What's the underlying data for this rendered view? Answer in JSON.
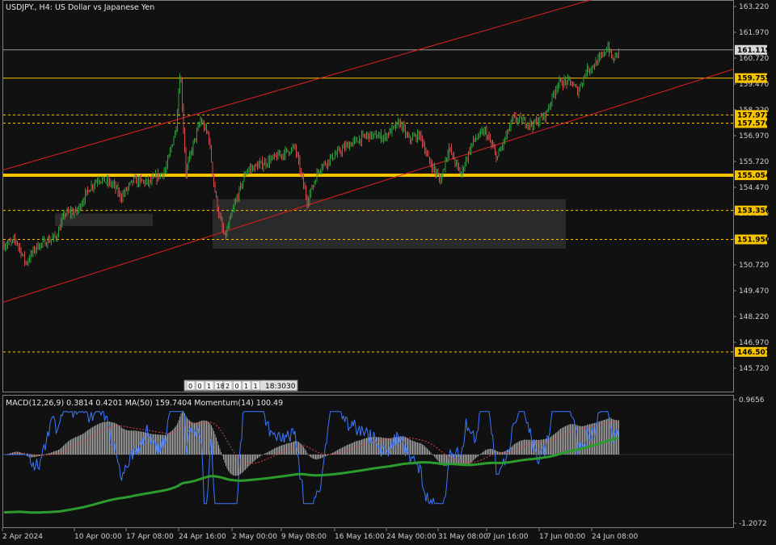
{
  "header": {
    "title": "USDJPY., H4:  US Dollar vs Japanese Yen",
    "macd_label": "MACD(12,26,9) 0.3814 0.4201 MA(50) 159.7404 Momentum(14) 100.49"
  },
  "colors": {
    "background": "#111111",
    "frame": "#808080",
    "bull_candle": "#2e9c3a",
    "bear_candle": "#d24a4a",
    "channel": "#e02020",
    "level": "#f5c300",
    "zone": "#2a2a2a",
    "macd_hist": "#c8c8c8",
    "macd_signal": "#e04040",
    "momentum": "#3a78ff",
    "ma": "#2c9c2c"
  },
  "chart_data": [
    {
      "type": "candlestick",
      "name": "USDJPY., H4",
      "y_ticks": [
        "163.220",
        "161.970",
        "160.720",
        "159.470",
        "158.220",
        "156.970",
        "155.720",
        "154.470",
        "153.220",
        "151.970",
        "150.720",
        "149.470",
        "148.220",
        "146.970",
        "145.720"
      ],
      "ylim": [
        144.7,
        163.55
      ],
      "x_ticks": [
        "2 Apr 2024",
        "10 Apr 00:00",
        "17 Apr 08:00",
        "24 Apr 16:00",
        "2 May 00:00",
        "9 May 08:00",
        "16 May 16:00",
        "24 May 00:00",
        "31 May 08:00",
        "7 Jun 16:00",
        "17 Jun 00:00",
        "24 Jun 08:00"
      ],
      "current_price": "161.119",
      "levels": [
        {
          "price": 159.755,
          "label": "159.755",
          "style": "solid"
        },
        {
          "price": 157.972,
          "label": "157.972",
          "style": "dashed"
        },
        {
          "price": 157.576,
          "label": "157.576",
          "style": "dashed"
        },
        {
          "price": 155.054,
          "label": "155.054",
          "style": "thick"
        },
        {
          "price": 153.35,
          "label": "153.350",
          "style": "dashed"
        },
        {
          "price": 151.95,
          "label": "151.950",
          "style": "dashed"
        },
        {
          "price": 146.507,
          "label": "146.507",
          "style": "dashed"
        }
      ],
      "channel_lines": [
        {
          "from": {
            "x": "2 Apr 2024",
            "y": 155.3
          },
          "to": {
            "x": "24 Jun 08:00",
            "y": 163.55
          }
        },
        {
          "from": {
            "x": "2 Apr 2024",
            "y": 148.9
          },
          "to": {
            "x": "24 Jun 08:00",
            "y": 158.0
          }
        }
      ],
      "zones": [
        {
          "x_start": "10 Apr 00:00",
          "x_end": "17 Apr 08:00",
          "y_low": 152.6,
          "y_high": 153.2
        },
        {
          "x_start": "2 May 00:00",
          "x_end": "17 Jun 00:00",
          "y_low": 151.5,
          "y_high": 153.9
        }
      ],
      "path_points": [
        [
          0,
          151.6
        ],
        [
          20,
          151.9
        ],
        [
          32,
          150.8
        ],
        [
          45,
          151.6
        ],
        [
          60,
          151.9
        ],
        [
          70,
          152.1
        ],
        [
          80,
          153.2
        ],
        [
          95,
          153.3
        ],
        [
          110,
          154.4
        ],
        [
          122,
          154.9
        ],
        [
          140,
          154.6
        ],
        [
          150,
          154.0
        ],
        [
          165,
          154.8
        ],
        [
          185,
          154.7
        ],
        [
          205,
          155.3
        ],
        [
          218,
          157.4
        ],
        [
          223,
          160.2
        ],
        [
          230,
          155.2
        ],
        [
          238,
          156.4
        ],
        [
          248,
          157.7
        ],
        [
          258,
          157.0
        ],
        [
          265,
          154.5
        ],
        [
          270,
          153.3
        ],
        [
          278,
          152.0
        ],
        [
          290,
          153.6
        ],
        [
          305,
          155.3
        ],
        [
          325,
          155.6
        ],
        [
          345,
          156.0
        ],
        [
          365,
          156.4
        ],
        [
          380,
          153.8
        ],
        [
          395,
          155.4
        ],
        [
          410,
          155.9
        ],
        [
          430,
          156.5
        ],
        [
          455,
          157.0
        ],
        [
          475,
          156.9
        ],
        [
          495,
          157.6
        ],
        [
          505,
          156.8
        ],
        [
          520,
          157.0
        ],
        [
          530,
          155.8
        ],
        [
          545,
          154.8
        ],
        [
          555,
          156.4
        ],
        [
          570,
          155.1
        ],
        [
          585,
          156.7
        ],
        [
          600,
          157.2
        ],
        [
          615,
          155.9
        ],
        [
          635,
          157.8
        ],
        [
          660,
          157.5
        ],
        [
          675,
          158.0
        ],
        [
          690,
          159.5
        ],
        [
          705,
          159.6
        ],
        [
          715,
          159.1
        ],
        [
          725,
          160.1
        ],
        [
          735,
          160.4
        ],
        [
          745,
          160.8
        ],
        [
          752,
          161.3
        ],
        [
          758,
          160.6
        ],
        [
          766,
          161.1
        ]
      ]
    },
    {
      "type": "macd",
      "title": "MACD(12,26,9) 0.3814 0.4201 MA(50) 159.7404 Momentum(14) 100.49",
      "y_ticks": [
        "0.9656",
        "-1.2072"
      ],
      "ylim": [
        -1.2072,
        0.9656
      ],
      "macd": 0.3814,
      "signal": 0.4201,
      "ma_value": 159.7404,
      "momentum": 100.49
    }
  ],
  "scroll_label": "18:30",
  "period_boxes": [
    "0",
    "0",
    "1",
    "18",
    "2",
    "0",
    "1",
    "1"
  ],
  "scroll_tail": "30"
}
